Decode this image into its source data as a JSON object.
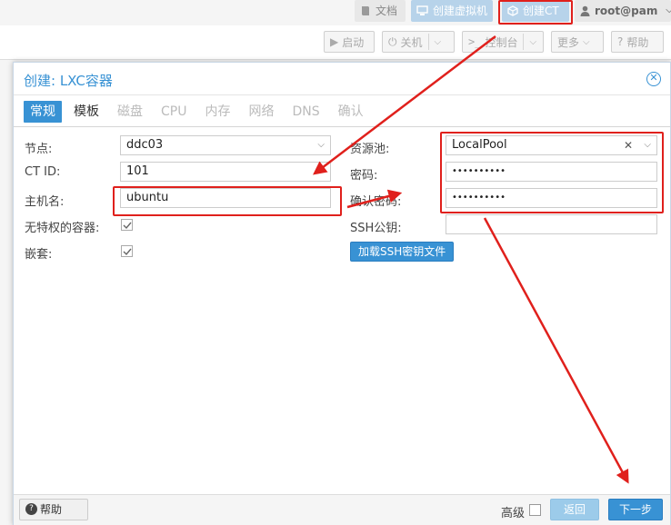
{
  "topbar": {
    "docs": "文档",
    "create_vm": "创建虚拟机",
    "create_ct": "创建CT",
    "user": "root@pam"
  },
  "toolbar": {
    "start": "启动",
    "shutdown": "关机",
    "console": "控制台",
    "more": "更多",
    "help": "帮助"
  },
  "dialog": {
    "title": "创建: LXC容器",
    "tabs": [
      "常规",
      "模板",
      "磁盘",
      "CPU",
      "内存",
      "网络",
      "DNS",
      "确认"
    ],
    "left": {
      "node_label": "节点:",
      "node_value": "ddc03",
      "ctid_label": "CT ID:",
      "ctid_value": "101",
      "hostname_label": "主机名:",
      "hostname_value": "ubuntu",
      "unprivileged_label": "无特权的容器:",
      "nesting_label": "嵌套:"
    },
    "right": {
      "pool_label": "资源池:",
      "pool_value": "LocalPool",
      "password_label": "密码:",
      "password_value": "••••••••••",
      "confirm_label": "确认密码:",
      "confirm_value": "••••••••••",
      "sshkey_label": "SSH公钥:",
      "sshkey_value": "",
      "load_ssh_button": "加载SSH密钥文件"
    },
    "footer": {
      "help": "帮助",
      "advanced": "高级",
      "back": "返回",
      "next": "下一步"
    }
  },
  "checkboxes": {
    "unprivileged": true,
    "nesting": true,
    "advanced": false
  },
  "colors": {
    "accent": "#3892d4",
    "annotation": "#e0201c"
  }
}
